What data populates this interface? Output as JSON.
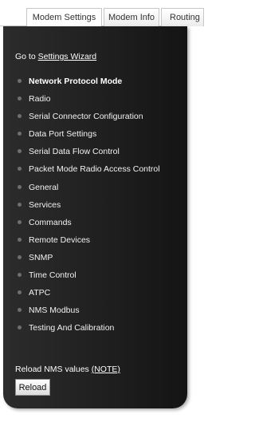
{
  "tabs": [
    {
      "label": "Modem Settings",
      "active": true
    },
    {
      "label": "Modem Info",
      "active": false
    },
    {
      "label": "Routing",
      "active": false
    }
  ],
  "sidebar": {
    "wizard_prefix": "Go to ",
    "wizard_link": "Settings Wizard",
    "items": [
      {
        "label": "Network Protocol Mode",
        "selected": true
      },
      {
        "label": "Radio"
      },
      {
        "label": "Serial Connector Configuration"
      },
      {
        "label": "Data Port Settings"
      },
      {
        "label": "Serial Data Flow Control"
      },
      {
        "label": "Packet Mode Radio Access Control"
      },
      {
        "label": "General"
      },
      {
        "label": "Services"
      },
      {
        "label": "Commands"
      },
      {
        "label": "Remote Devices"
      },
      {
        "label": "SNMP"
      },
      {
        "label": "Time Control"
      },
      {
        "label": "ATPC"
      },
      {
        "label": "NMS Modbus"
      },
      {
        "label": "Testing And Calibration"
      }
    ],
    "reload_prefix": "Reload NMS values ",
    "reload_note": "(NOTE)",
    "reload_button": "Reload"
  },
  "colors": {
    "sidebar_background": "#1e1e1e",
    "tab_border": "#c7c7c7",
    "bullet": "#6f6f6f"
  }
}
